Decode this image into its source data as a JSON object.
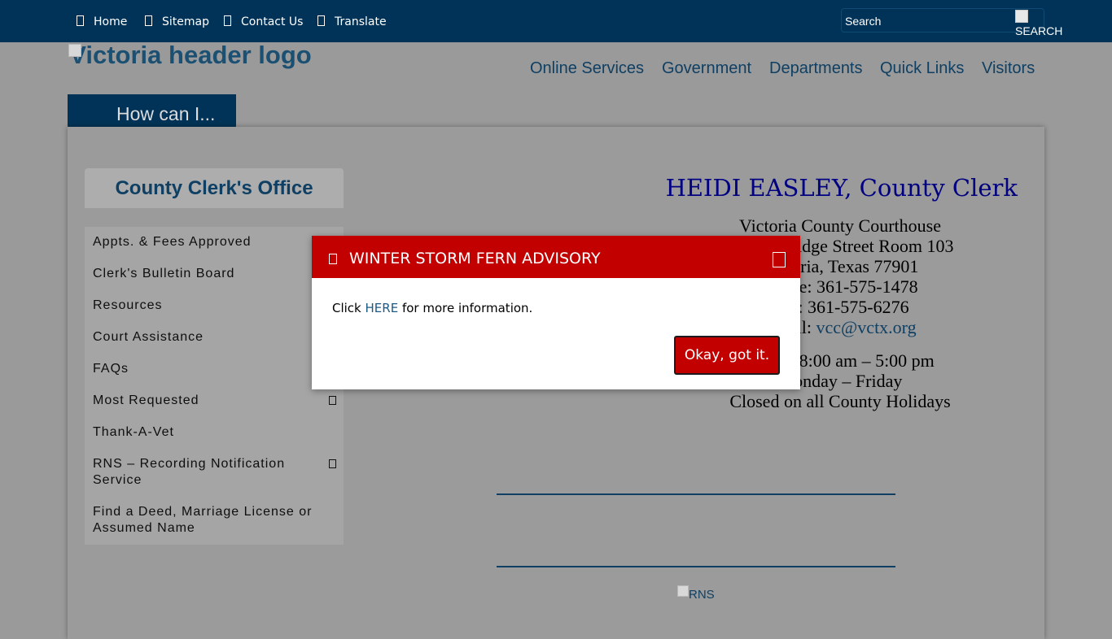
{
  "topbar": {
    "links": [
      {
        "label": "Home"
      },
      {
        "label": "Sitemap"
      },
      {
        "label": "Contact Us"
      },
      {
        "label": "Translate"
      }
    ],
    "search_placeholder": "Search",
    "search_button": "SEARCH"
  },
  "header": {
    "logo_alt": "Victoria header logo",
    "how_can_i": "How can I...",
    "nav": [
      "Online Services",
      "Government",
      "Departments",
      "Quick Links",
      "Visitors"
    ]
  },
  "sidebar": {
    "title": "County Clerk's Office",
    "items": [
      {
        "label": "Appts. & Fees Approved"
      },
      {
        "label": "Clerk's Bulletin Board"
      },
      {
        "label": "Resources"
      },
      {
        "label": "Court Assistance"
      },
      {
        "label": "FAQs"
      },
      {
        "label": "Most Requested"
      },
      {
        "label": "Thank-A-Vet"
      },
      {
        "label": "RNS – Recording Notification Service"
      },
      {
        "label": "Find a Deed, Marriage License or Assumed Name"
      }
    ]
  },
  "main": {
    "clerk_title": "HEIDI EASLEY, County Clerk",
    "info_lines": [
      "Victoria County Courthouse",
      "115 N. Bridge Street Room 103",
      "Victoria, Texas  77901",
      "Phone:  361-575-1478",
      "Fax:  361-575-6276",
      "Email: "
    ],
    "email": "vcc@vctx.org",
    "hours": [
      "Hours: 8:00 am – 5:00 pm",
      "Monday – Friday",
      "Closed on all County Holidays"
    ],
    "rns_alt": "RNS"
  },
  "modal": {
    "title": "WINTER STORM FERN ADVISORY",
    "body_prefix": "Click ",
    "body_link": "HERE",
    "body_suffix": " for more information.",
    "button": "Okay, got it."
  },
  "colors": {
    "topbar": "#003357",
    "modal_header": "#c20000",
    "link": "#0f3f63",
    "clerk_title": "#000080"
  }
}
